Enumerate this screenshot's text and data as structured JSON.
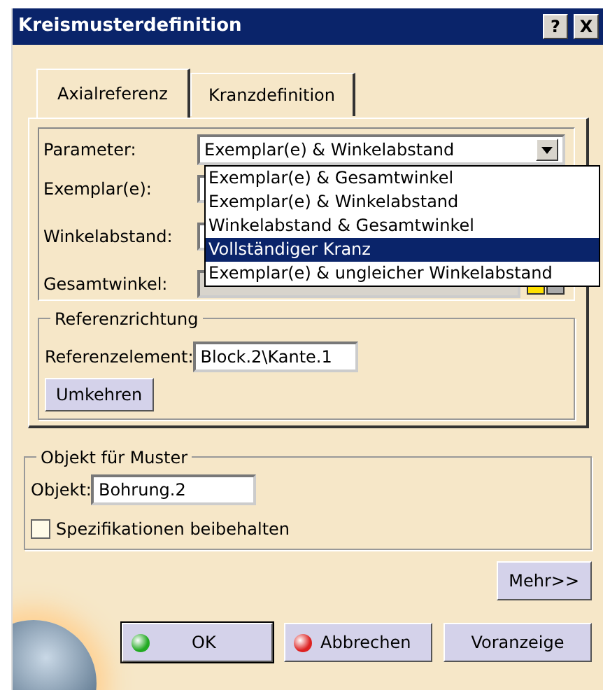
{
  "window": {
    "title": "Kreismusterdefinition",
    "help_button": "?",
    "close_button": "X"
  },
  "tabs": [
    {
      "label": "Axialreferenz",
      "selected": true
    },
    {
      "label": "Kranzdefinition",
      "selected": false
    }
  ],
  "parameter": {
    "label": "Parameter:",
    "value": "Exemplar(e) & Winkelabstand",
    "options": [
      {
        "label": "Exemplar(e) & Gesamtwinkel",
        "highlighted": false
      },
      {
        "label": "Exemplar(e) & Winkelabstand",
        "highlighted": false
      },
      {
        "label": "Winkelabstand & Gesamtwinkel",
        "highlighted": false
      },
      {
        "label": "Vollständiger Kranz",
        "highlighted": true
      },
      {
        "label": "Exemplar(e) & ungleicher Winkelabstand",
        "highlighted": false
      }
    ]
  },
  "fields": [
    {
      "label": "Exemplar(e):",
      "disabled": false
    },
    {
      "label": "Winkelabstand:",
      "disabled": false
    },
    {
      "label": "Gesamtwinkel:",
      "disabled": true
    }
  ],
  "reference_direction": {
    "title": "Referenzrichtung",
    "label": "Referenzelement:",
    "value": "Block.2\\Kante.1",
    "button": "Umkehren"
  },
  "object_group": {
    "title": "Objekt für Muster",
    "label": "Objekt:",
    "value": "Bohrung.2",
    "checkbox": {
      "label": "Spezifikationen beibehalten",
      "checked": false
    }
  },
  "more_button": "Mehr>>",
  "buttons": [
    {
      "label": "OK",
      "kind": "ok"
    },
    {
      "label": "Abbrechen",
      "kind": "cancel"
    },
    {
      "label": "Voranzeige",
      "kind": "plain"
    }
  ]
}
